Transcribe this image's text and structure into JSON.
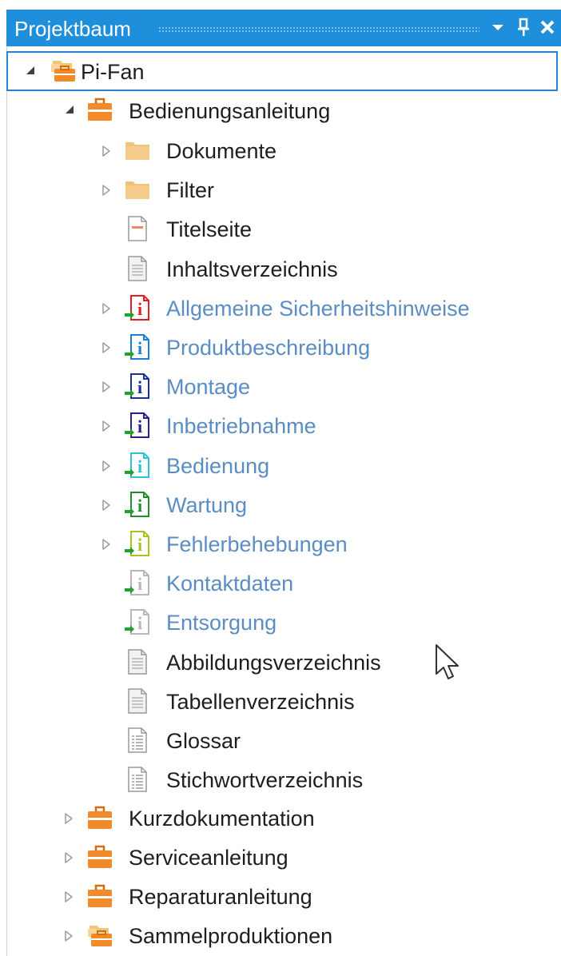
{
  "panel": {
    "title": "Projektbaum",
    "dropdown_icon": "chevron-down-icon",
    "pin_icon": "pin-icon",
    "close_icon": "close-icon"
  },
  "colors": {
    "titlebar": "#1f8fdc",
    "link_text": "#5b8dc3",
    "dark_text": "#1e1e1e",
    "selection_border": "#2d7fd0"
  },
  "tree": {
    "root": {
      "label": "Pi-Fan",
      "icon": "project-root-icon",
      "expanded": true
    },
    "bedienungsanleitung": {
      "label": "Bedienungsanleitung",
      "icon": "briefcase-icon",
      "expanded": true
    },
    "items": [
      {
        "label": "Dokumente",
        "icon": "folder-icon",
        "expandable": true,
        "style": "dark"
      },
      {
        "label": "Filter",
        "icon": "folder-icon",
        "expandable": true,
        "style": "dark"
      },
      {
        "label": "Titelseite",
        "icon": "title-page-icon",
        "expandable": false,
        "style": "dark"
      },
      {
        "label": "Inhaltsverzeichnis",
        "icon": "document-icon",
        "expandable": false,
        "style": "dark"
      },
      {
        "label": "Allgemeine Sicherheitshinweise",
        "icon": "info-link-icon",
        "color": "#e02020",
        "expandable": true,
        "style": "link"
      },
      {
        "label": "Produktbeschreibung",
        "icon": "info-link-icon",
        "color": "#1e7be0",
        "expandable": true,
        "style": "link"
      },
      {
        "label": "Montage",
        "icon": "info-link-icon",
        "color": "#1a2f9c",
        "expandable": true,
        "style": "link"
      },
      {
        "label": "Inbetriebnahme",
        "icon": "info-link-icon",
        "color": "#2a1f8f",
        "expandable": true,
        "style": "link"
      },
      {
        "label": "Bedienung",
        "icon": "info-link-icon",
        "color": "#2cc3d6",
        "expandable": true,
        "style": "link"
      },
      {
        "label": "Wartung",
        "icon": "info-link-icon",
        "color": "#1f8f2a",
        "expandable": true,
        "style": "link"
      },
      {
        "label": "Fehlerbehebungen",
        "icon": "info-link-icon",
        "color": "#a8c41e",
        "expandable": true,
        "style": "link"
      },
      {
        "label": "Kontaktdaten",
        "icon": "info-link-icon",
        "color": "#b8b8b8",
        "expandable": false,
        "style": "link"
      },
      {
        "label": "Entsorgung",
        "icon": "info-link-icon",
        "color": "#b8b8b8",
        "expandable": false,
        "style": "link"
      },
      {
        "label": "Abbildungsverzeichnis",
        "icon": "document-icon",
        "expandable": false,
        "style": "dark"
      },
      {
        "label": "Tabellenverzeichnis",
        "icon": "document-icon",
        "expandable": false,
        "style": "dark"
      },
      {
        "label": "Glossar",
        "icon": "list-document-icon",
        "expandable": false,
        "style": "dark"
      },
      {
        "label": "Stichwortverzeichnis",
        "icon": "list-document-icon",
        "expandable": false,
        "style": "dark"
      }
    ],
    "siblings": [
      {
        "label": "Kurzdokumentation",
        "icon": "briefcase-icon"
      },
      {
        "label": "Serviceanleitung",
        "icon": "briefcase-icon"
      },
      {
        "label": "Reparaturanleitung",
        "icon": "briefcase-icon"
      },
      {
        "label": "Sammelproduktionen",
        "icon": "project-root-icon"
      }
    ]
  }
}
